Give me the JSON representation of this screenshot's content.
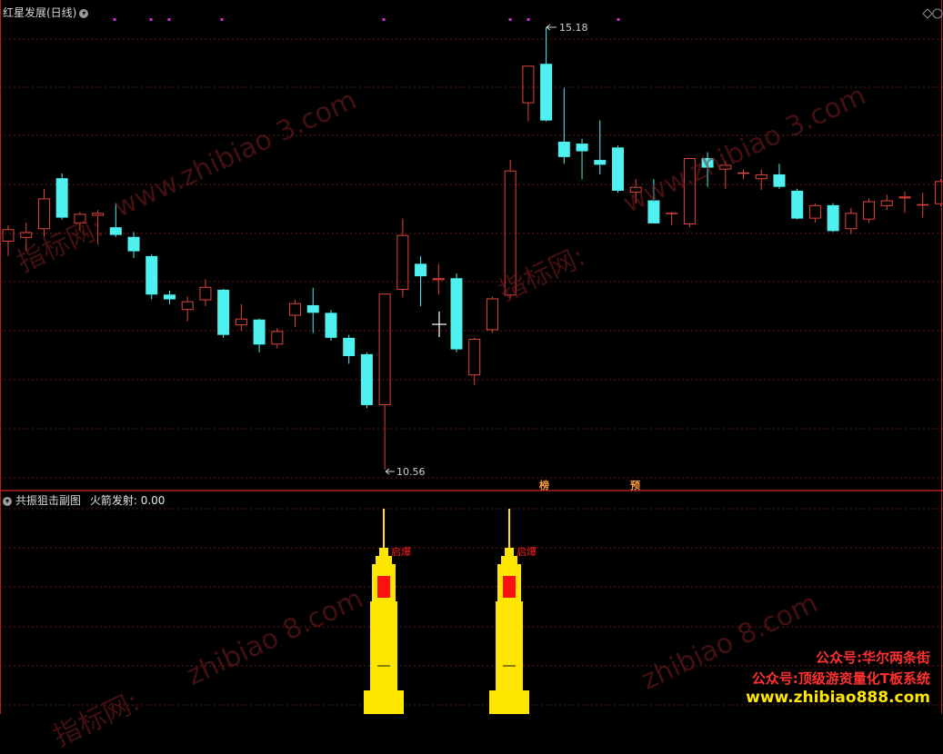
{
  "main_panel": {
    "title": "红星发展(日线)",
    "high_label": "15.18",
    "low_label": "10.56",
    "markers": [
      "榜",
      "预"
    ],
    "candles": [
      {
        "o": 12.95,
        "c": 13.08,
        "h": 13.12,
        "l": 12.8,
        "t": "up"
      },
      {
        "o": 12.99,
        "c": 13.05,
        "h": 13.15,
        "l": 12.85,
        "t": "up"
      },
      {
        "o": 13.08,
        "c": 13.4,
        "h": 13.5,
        "l": 13.0,
        "t": "up"
      },
      {
        "o": 13.61,
        "c": 13.2,
        "h": 13.66,
        "l": 13.18,
        "t": "down"
      },
      {
        "o": 13.14,
        "c": 13.24,
        "h": 13.26,
        "l": 13.07,
        "t": "up"
      },
      {
        "o": 13.22,
        "c": 13.25,
        "h": 13.28,
        "l": 12.92,
        "t": "up"
      },
      {
        "o": 13.1,
        "c": 13.02,
        "h": 13.35,
        "l": 13.0,
        "t": "down"
      },
      {
        "o": 13.0,
        "c": 12.85,
        "h": 13.05,
        "l": 12.78,
        "t": "down"
      },
      {
        "o": 12.8,
        "c": 12.4,
        "h": 12.82,
        "l": 12.35,
        "t": "down"
      },
      {
        "o": 12.4,
        "c": 12.35,
        "h": 12.44,
        "l": 12.3,
        "t": "down"
      },
      {
        "o": 12.24,
        "c": 12.33,
        "h": 12.38,
        "l": 12.12,
        "t": "up"
      },
      {
        "o": 12.34,
        "c": 12.48,
        "h": 12.56,
        "l": 12.28,
        "t": "up"
      },
      {
        "o": 12.45,
        "c": 11.98,
        "h": 12.46,
        "l": 11.95,
        "t": "down"
      },
      {
        "o": 12.08,
        "c": 12.15,
        "h": 12.3,
        "l": 12.02,
        "t": "up"
      },
      {
        "o": 12.14,
        "c": 11.88,
        "h": 12.15,
        "l": 11.8,
        "t": "down"
      },
      {
        "o": 11.88,
        "c": 12.02,
        "h": 12.05,
        "l": 11.84,
        "t": "up"
      },
      {
        "o": 12.18,
        "c": 12.31,
        "h": 12.35,
        "l": 12.06,
        "t": "up"
      },
      {
        "o": 12.29,
        "c": 12.21,
        "h": 12.47,
        "l": 12.0,
        "t": "down"
      },
      {
        "o": 12.21,
        "c": 11.95,
        "h": 12.24,
        "l": 11.92,
        "t": "down"
      },
      {
        "o": 11.95,
        "c": 11.76,
        "h": 11.98,
        "l": 11.68,
        "t": "down"
      },
      {
        "o": 11.78,
        "c": 11.25,
        "h": 11.8,
        "l": 11.22,
        "t": "down"
      },
      {
        "o": 11.25,
        "c": 12.41,
        "h": 12.41,
        "l": 10.58,
        "t": "up"
      },
      {
        "o": 12.45,
        "c": 13.02,
        "h": 13.19,
        "l": 12.37,
        "t": "up"
      },
      {
        "o": 12.72,
        "c": 12.59,
        "h": 12.8,
        "l": 12.28,
        "t": "down"
      },
      {
        "o": 12.55,
        "c": 12.57,
        "h": 12.72,
        "l": 12.4,
        "t": "up"
      },
      {
        "o": 12.57,
        "c": 11.83,
        "h": 12.62,
        "l": 11.8,
        "t": "down"
      },
      {
        "o": 11.56,
        "c": 11.94,
        "h": 11.95,
        "l": 11.46,
        "t": "up"
      },
      {
        "o": 12.03,
        "c": 12.36,
        "h": 12.38,
        "l": 12.0,
        "t": "up"
      },
      {
        "o": 12.39,
        "c": 13.69,
        "h": 13.8,
        "l": 12.36,
        "t": "up"
      },
      {
        "o": 14.39,
        "c": 14.78,
        "h": 14.78,
        "l": 14.2,
        "t": "up"
      },
      {
        "o": 14.8,
        "c": 14.21,
        "h": 15.18,
        "l": 14.2,
        "t": "down"
      },
      {
        "o": 13.99,
        "c": 13.83,
        "h": 14.55,
        "l": 13.76,
        "t": "down"
      },
      {
        "o": 13.97,
        "c": 13.89,
        "h": 14.02,
        "l": 13.6,
        "t": "down"
      },
      {
        "o": 13.8,
        "c": 13.75,
        "h": 14.21,
        "l": 13.65,
        "t": "down"
      },
      {
        "o": 13.93,
        "c": 13.48,
        "h": 13.95,
        "l": 13.46,
        "t": "down"
      },
      {
        "o": 13.46,
        "c": 13.52,
        "h": 13.6,
        "l": 13.35,
        "t": "up"
      },
      {
        "o": 13.38,
        "c": 13.14,
        "h": 13.6,
        "l": 13.14,
        "t": "down"
      },
      {
        "o": 13.24,
        "c": 13.25,
        "h": 13.26,
        "l": 13.12,
        "t": "up"
      },
      {
        "o": 13.13,
        "c": 13.82,
        "h": 13.82,
        "l": 13.1,
        "t": "up"
      },
      {
        "o": 13.82,
        "c": 13.72,
        "h": 13.88,
        "l": 13.52,
        "t": "down"
      },
      {
        "o": 13.7,
        "c": 13.75,
        "h": 13.79,
        "l": 13.5,
        "t": "up"
      },
      {
        "o": 13.66,
        "c": 13.67,
        "h": 13.7,
        "l": 13.6,
        "t": "up"
      },
      {
        "o": 13.6,
        "c": 13.65,
        "h": 13.7,
        "l": 13.49,
        "t": "up"
      },
      {
        "o": 13.65,
        "c": 13.52,
        "h": 13.76,
        "l": 13.5,
        "t": "down"
      },
      {
        "o": 13.48,
        "c": 13.19,
        "h": 13.5,
        "l": 13.18,
        "t": "down"
      },
      {
        "o": 13.19,
        "c": 13.33,
        "h": 13.35,
        "l": 13.15,
        "t": "up"
      },
      {
        "o": 13.33,
        "c": 13.06,
        "h": 13.35,
        "l": 13.05,
        "t": "down"
      },
      {
        "o": 13.08,
        "c": 13.25,
        "h": 13.3,
        "l": 13.03,
        "t": "up"
      },
      {
        "o": 13.18,
        "c": 13.37,
        "h": 13.4,
        "l": 13.15,
        "t": "up"
      },
      {
        "o": 13.32,
        "c": 13.38,
        "h": 13.44,
        "l": 13.28,
        "t": "up"
      },
      {
        "o": 13.4,
        "c": 13.42,
        "h": 13.47,
        "l": 13.25,
        "t": "up"
      },
      {
        "o": 13.33,
        "c": 13.34,
        "h": 13.46,
        "l": 13.2,
        "t": "up"
      },
      {
        "o": 13.34,
        "c": 13.58,
        "h": 13.6,
        "l": 13.32,
        "t": "up"
      }
    ],
    "dot_color": "#d030d0",
    "up_color": "#e0443c",
    "down_color": "#4ef0f0"
  },
  "sub_panel": {
    "title": "共振狙击副图",
    "indicator_label": "火箭发射: 0.00",
    "rocket_labels": [
      "启爆",
      "启爆"
    ],
    "rocket_color": "#ffe600",
    "window_color": "#ff1010"
  },
  "watermarks": {
    "site": "www.zhibiao  3.com",
    "site_short": "zhibiao  8.com",
    "cn": "指标网:"
  },
  "promo": {
    "line1": "公众号:华尔两条街",
    "line2": "公众号:顶级游资量化T板系统",
    "line3": "www.zhibiao888.com"
  }
}
